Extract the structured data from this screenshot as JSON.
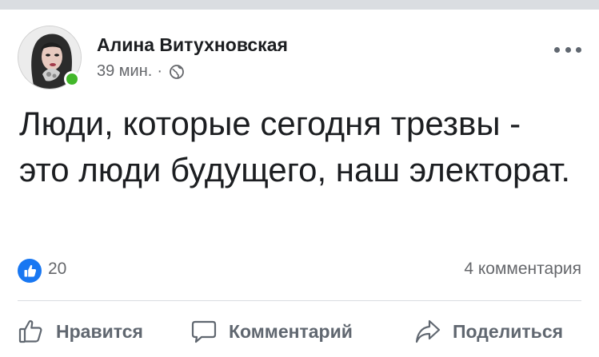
{
  "post": {
    "author": "Алина Витухновская",
    "time": "39 мин.",
    "separator": "·",
    "audience_icon": "globe-icon",
    "more_icon": "more-options-icon",
    "online": true,
    "text": "Люди, которые сегодня трезвы - это люди будущего, наш электорат."
  },
  "stats": {
    "reaction_icon": "like-reaction-icon",
    "likes": "20",
    "comments": "4 комментария"
  },
  "actions": {
    "like_label": "Нравится",
    "comment_label": "Комментарий",
    "share_label": "Поделиться"
  },
  "colors": {
    "accent": "#1877f2",
    "online": "#42b72a",
    "text": "#1c1e21",
    "secondary": "#65676b",
    "divider": "#dadde1"
  }
}
